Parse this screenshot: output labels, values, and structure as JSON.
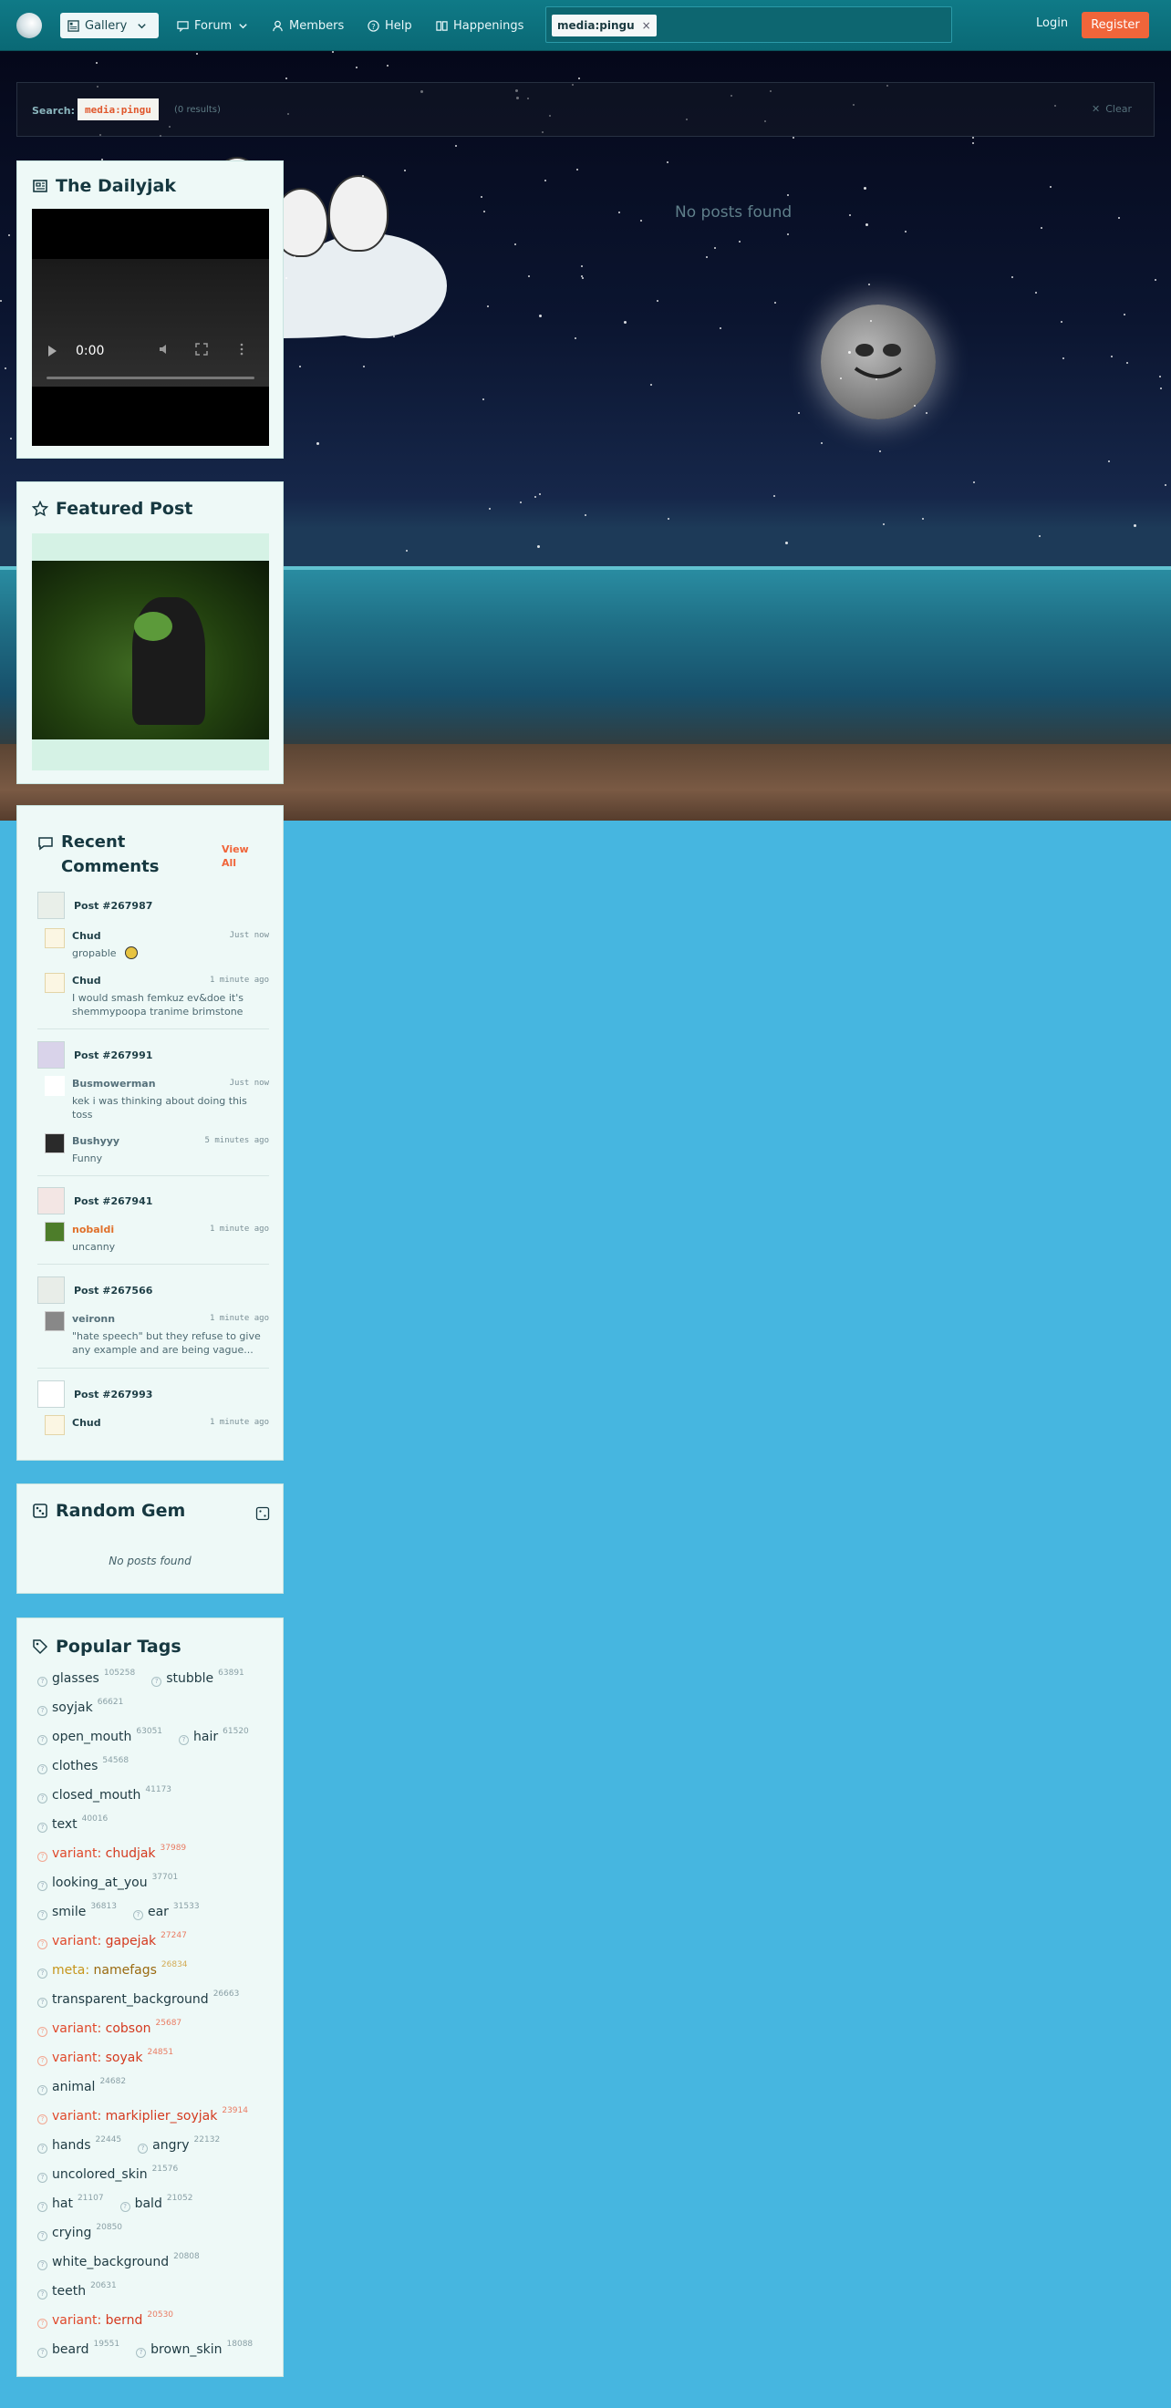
{
  "nav": {
    "gallery": "Gallery",
    "forum": "Forum",
    "members": "Members",
    "help": "Help",
    "happenings": "Happenings",
    "search_chip": "media:pingu",
    "login": "Login",
    "register": "Register"
  },
  "search": {
    "label": "Search:",
    "term": "media:pingu",
    "results": "(0 results)",
    "clear": "Clear",
    "empty": "No posts found"
  },
  "dailyjak": {
    "title": "The Dailyjak",
    "video_time": "0:00"
  },
  "featured": {
    "title": "Featured Post"
  },
  "comments": {
    "title": "Recent Comments",
    "view_all": "View All",
    "groups": [
      {
        "post": "Post #267987",
        "items": [
          {
            "user": "Chud",
            "time": "Just now",
            "text": "gropable"
          },
          {
            "user": "Chud",
            "time": "1 minute ago",
            "text": "I would smash femkuz ev&doe it's shemmypoopa tranime brimstone"
          }
        ]
      },
      {
        "post": "Post #267991",
        "items": [
          {
            "user": "Busmowerman",
            "time": "Just now",
            "text": "kek i was thinking about doing this toss"
          },
          {
            "user": "Bushyyy",
            "time": "5 minutes ago",
            "text": "Funny"
          }
        ]
      },
      {
        "post": "Post #267941",
        "items": [
          {
            "user": "nobaldi",
            "time": "1 minute ago",
            "text": "uncanny"
          }
        ]
      },
      {
        "post": "Post #267566",
        "items": [
          {
            "user": "veironn",
            "time": "1 minute ago",
            "text": "\"hate speech\" but they refuse to give any example and are being vague..."
          }
        ]
      },
      {
        "post": "Post #267993",
        "items": [
          {
            "user": "Chud",
            "time": "1 minute ago",
            "text": ""
          }
        ]
      }
    ]
  },
  "random_gem": {
    "title": "Random Gem",
    "empty": "No posts found"
  },
  "tags": {
    "title": "Popular Tags",
    "lines": [
      [
        {
          "name": "glasses",
          "count": "105258"
        },
        {
          "name": "stubble",
          "count": "63891"
        }
      ],
      [
        {
          "name": "soyjak",
          "count": "66621"
        }
      ],
      [
        {
          "name": "open_mouth",
          "count": "63051"
        },
        {
          "name": "hair",
          "count": "61520"
        }
      ],
      [
        {
          "name": "clothes",
          "count": "54568"
        }
      ],
      [
        {
          "name": "closed_mouth",
          "count": "41173"
        }
      ],
      [
        {
          "name": "text",
          "count": "40016"
        }
      ],
      [
        {
          "prefix": "variant:",
          "name": "chudjak",
          "count": "37989",
          "kind": "variant"
        }
      ],
      [
        {
          "name": "looking_at_you",
          "count": "37701"
        }
      ],
      [
        {
          "name": "smile",
          "count": "36813"
        },
        {
          "name": "ear",
          "count": "31533"
        }
      ],
      [
        {
          "prefix": "variant:",
          "name": "gapejak",
          "count": "27247",
          "kind": "variant"
        }
      ],
      [
        {
          "prefix": "meta:",
          "name": "namefags",
          "count": "26834",
          "kind": "meta"
        }
      ],
      [
        {
          "name": "transparent_background",
          "count": "26663"
        }
      ],
      [
        {
          "prefix": "variant:",
          "name": "cobson",
          "count": "25687",
          "kind": "variant"
        }
      ],
      [
        {
          "prefix": "variant:",
          "name": "soyak",
          "count": "24851",
          "kind": "variant"
        }
      ],
      [
        {
          "name": "animal",
          "count": "24682"
        }
      ],
      [
        {
          "prefix": "variant:",
          "name": "markiplier_soyjak",
          "count": "23914",
          "kind": "variant"
        }
      ],
      [
        {
          "name": "hands",
          "count": "22445"
        },
        {
          "name": "angry",
          "count": "22132"
        }
      ],
      [
        {
          "name": "uncolored_skin",
          "count": "21576"
        }
      ],
      [
        {
          "name": "hat",
          "count": "21107"
        },
        {
          "name": "bald",
          "count": "21052"
        }
      ],
      [
        {
          "name": "crying",
          "count": "20850"
        }
      ],
      [
        {
          "name": "white_background",
          "count": "20808"
        }
      ],
      [
        {
          "name": "teeth",
          "count": "20631"
        }
      ],
      [
        {
          "prefix": "variant:",
          "name": "bernd",
          "count": "20530",
          "kind": "variant"
        }
      ],
      [
        {
          "name": "beard",
          "count": "19551"
        },
        {
          "name": "brown_skin",
          "count": "18088"
        }
      ]
    ]
  },
  "colors": {
    "accent": "#f0653a",
    "topbar": "#0f7a87",
    "page_bg": "#46b6e0",
    "panel_bg": "#eef9f7",
    "variant_tag": "#d43a1f",
    "meta_tag": "#9a6a10"
  }
}
